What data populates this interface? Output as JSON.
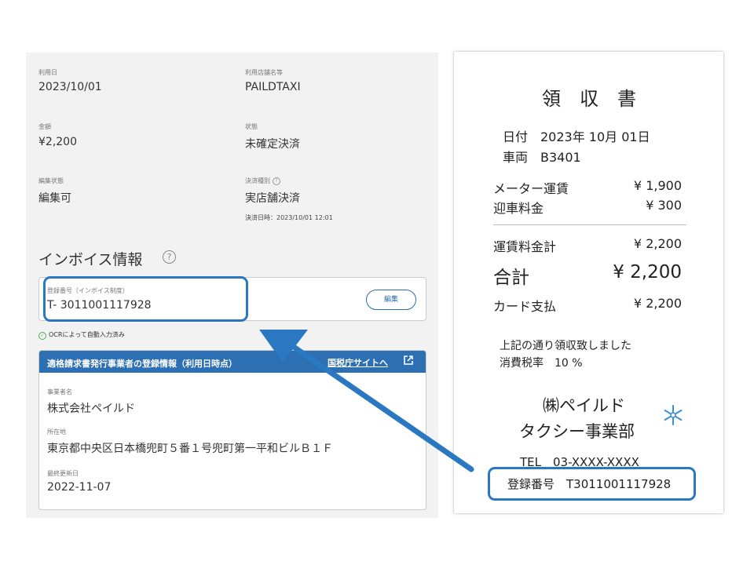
{
  "detail": {
    "use_date": {
      "label": "利用日",
      "value": "2023/10/01"
    },
    "store_name": {
      "label": "利用店舗名等",
      "value": "PAILDTAXI"
    },
    "amount": {
      "label": "金額",
      "value": "¥2,200"
    },
    "status": {
      "label": "状態",
      "value": "未確定決済"
    },
    "edit_status": {
      "label": "編集状態",
      "value": "編集可"
    },
    "payment_type": {
      "label": "決済種別",
      "value": "実店舗決済",
      "sub": "決済日時：2023/10/01 12:01"
    }
  },
  "invoice": {
    "title": "インボイス情報",
    "help_icon": "question-circle-icon",
    "reg_field": {
      "label": "登録番号（インボイス制度）",
      "value": "T- 3011001117928"
    },
    "edit_label": "編集",
    "ocr_note": "OCRによって自動入力済み",
    "info": {
      "header": "適格請求書発行事業者の登録情報（利用日時点）",
      "link": "国税庁サイトへ",
      "link_icon": "external-link-icon",
      "company": {
        "label": "事業者名",
        "value": "株式会社ペイルド"
      },
      "address": {
        "label": "所在地",
        "value": "東京都中央区日本橋兜町５番１号兜町第一平和ビルＢ１Ｆ"
      },
      "updated": {
        "label": "最終更新日",
        "value": "2022-11-07"
      }
    }
  },
  "receipt": {
    "title": "領　収　書",
    "date": "日付　2023年 10月 01日",
    "vehicle": "車両　B3401",
    "items": [
      {
        "label": "メーター運賃",
        "amount": "¥ 1,900"
      },
      {
        "label": "迎車料金",
        "amount": "¥ 300"
      }
    ],
    "subtotal": {
      "label": "運賃料金計",
      "amount": "¥ 2,200"
    },
    "total": {
      "label": "合計",
      "amount": "¥ 2,200"
    },
    "card": {
      "label": "カード支払",
      "amount": "¥ 2,200"
    },
    "note1": "上記の通り領収致しました",
    "note2": "消費税率　10 %",
    "company1": "㈱ペイルド",
    "company2": "タクシー事業部",
    "logo_icon": "snowflake-logo-icon",
    "tel": "TEL　03-XXXX-XXXX",
    "reg_no": "登録番号　T3011001117928"
  },
  "colors": {
    "accent": "#2d6fb3",
    "highlight": "#2a78c2",
    "ocr_check": "#4caf50"
  }
}
